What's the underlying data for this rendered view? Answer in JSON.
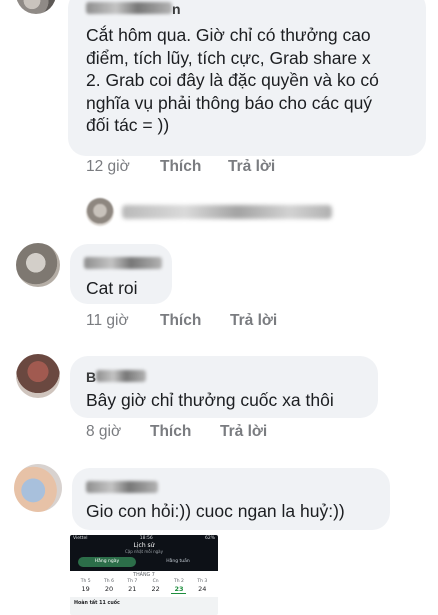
{
  "comments": [
    {
      "name_tail": "n",
      "text": "Cắt hôm qua. Giờ chỉ có thưởng cao\nđiểm, tích lũy, tích cực, Grab share x\n2. Grab coi đây là đặc quyền và ko có\nnghĩa vụ phải thông báo cho các quý\nđối tác = ))",
      "time": "12 giờ",
      "like": "Thích",
      "reply": "Trả lời"
    },
    {
      "name_tail": "",
      "text": "Cat roi",
      "time": "11 giờ",
      "like": "Thích",
      "reply": "Trả lời"
    },
    {
      "name_tail": "B",
      "text": "Bây giờ chỉ thưởng cuốc xa thôi",
      "time": "8 giờ",
      "like": "Thích",
      "reply": "Trả lời"
    },
    {
      "name_tail": "",
      "text": "Gio con hỏi:)) cuoc ngan la huỷ:))",
      "time": "",
      "like": "",
      "reply": ""
    }
  ],
  "screenshot": {
    "status_left": "Viettel",
    "status_time": "18:56",
    "status_right": "62%",
    "title": "Lịch sử",
    "subtitle": "Cập nhật mỗi ngày",
    "tab_day": "Hằng ngày",
    "tab_week": "Hằng tuần",
    "month": "THÁNG 7",
    "days": [
      {
        "name": "Th 5",
        "date": "19"
      },
      {
        "name": "Th 6",
        "date": "20"
      },
      {
        "name": "Th 7",
        "date": "21"
      },
      {
        "name": "Cn",
        "date": "22"
      },
      {
        "name": "Th 2",
        "date": "23"
      },
      {
        "name": "Th 3",
        "date": "24"
      }
    ],
    "footer": "Hoàn tất 11 cuốc"
  }
}
